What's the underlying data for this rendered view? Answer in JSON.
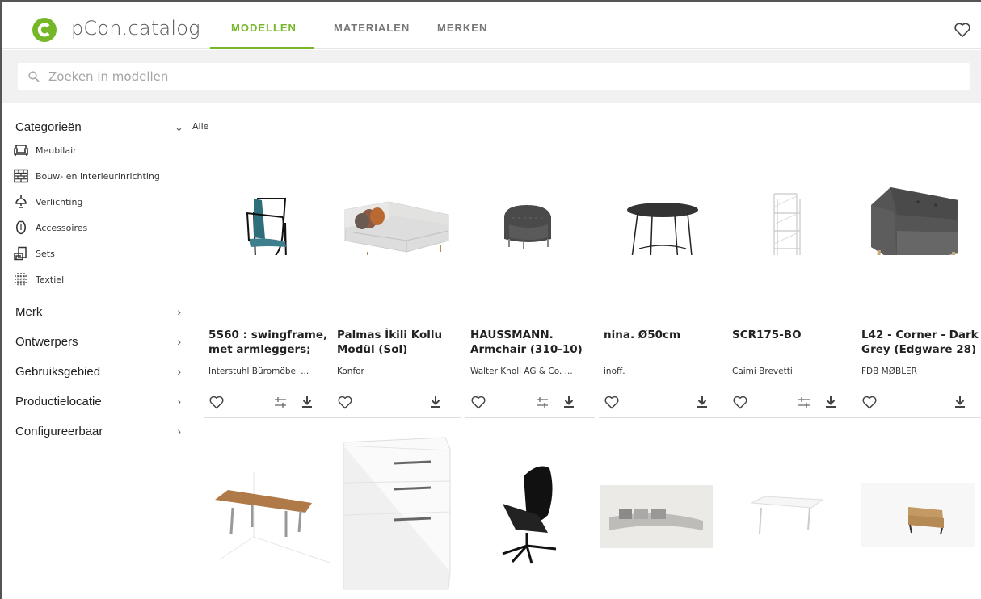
{
  "header": {
    "brand": "pCon.catalog",
    "tabs": [
      {
        "label": "MODELLEN",
        "active": true
      },
      {
        "label": "MATERIALEN",
        "active": false
      },
      {
        "label": "MERKEN",
        "active": false
      }
    ],
    "accent_color": "#76b729"
  },
  "search": {
    "placeholder": "Zoeken in modellen",
    "value": ""
  },
  "sidebar": {
    "categories_title": "Categorieën",
    "categories": [
      {
        "label": "Meubilair",
        "icon": "sofa-icon"
      },
      {
        "label": "Bouw- en interieurinrichting",
        "icon": "wall-icon"
      },
      {
        "label": "Verlichting",
        "icon": "lamp-icon"
      },
      {
        "label": "Accessoires",
        "icon": "vase-icon"
      },
      {
        "label": "Sets",
        "icon": "sets-icon"
      },
      {
        "label": "Textiel",
        "icon": "textile-icon"
      }
    ],
    "filters": [
      {
        "label": "Merk"
      },
      {
        "label": "Ontwerpers"
      },
      {
        "label": "Gebruiksgebied"
      },
      {
        "label": "Productielocatie"
      },
      {
        "label": "Configureerbaar"
      }
    ]
  },
  "breadcrumb": "Alle",
  "products": [
    {
      "title": "5S60 : swingframe, met armleggers;",
      "maker": "Interstuhl Büromöbel ...",
      "configurable": true,
      "image": "cantilever-chair"
    },
    {
      "title": "Palmas İkili Kollu Modül (Sol)",
      "maker": "Konfor",
      "configurable": false,
      "image": "sofa"
    },
    {
      "title": "HAUSSMANN. Armchair (310-10)",
      "maker": "Walter Knoll AG & Co. ...",
      "configurable": true,
      "image": "armchair"
    },
    {
      "title": "nina. Ø50cm",
      "maker": "inoff.",
      "configurable": false,
      "image": "side-table"
    },
    {
      "title": "SCR175-BO",
      "maker": "Caimi Brevetti",
      "configurable": true,
      "image": "shelf"
    },
    {
      "title": "L42 - Corner - Dark Grey (Edgware 28)",
      "maker": "FDB MØBLER",
      "configurable": false,
      "image": "corner-sofa"
    },
    {
      "title": "",
      "maker": "",
      "configurable": false,
      "image": "long-table"
    },
    {
      "title": "",
      "maker": "",
      "configurable": false,
      "image": "drawer-cabinet"
    },
    {
      "title": "",
      "maker": "",
      "configurable": false,
      "image": "office-chair"
    },
    {
      "title": "",
      "maker": "",
      "configurable": false,
      "image": "curved-sofa"
    },
    {
      "title": "",
      "maker": "",
      "configurable": false,
      "image": "desk"
    },
    {
      "title": "",
      "maker": "",
      "configurable": false,
      "image": "small-sofa"
    }
  ]
}
